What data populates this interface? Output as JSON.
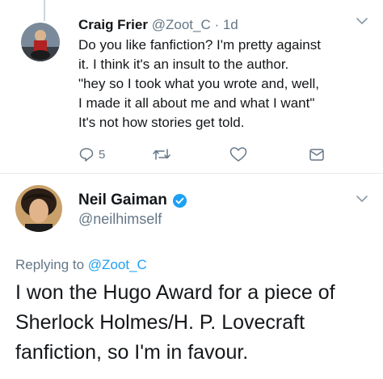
{
  "tweet1": {
    "name": "Craig Frier",
    "handle": "@Zoot_C",
    "time": "· 1d",
    "lines": [
      "Do you like fanfiction? I'm pretty against",
      "it. I think it's an insult to the author.",
      "\"hey so I took what you wrote and, well,",
      "I made it all about me and what I want\"",
      "It's not how stories get told."
    ],
    "reply_count": "5",
    "icons": [
      "reply-icon",
      "retweet-icon",
      "like-icon",
      "message-icon",
      "chevron-down-icon"
    ]
  },
  "tweet2": {
    "name": "Neil Gaiman",
    "handle": "@neilhimself",
    "verified": true,
    "replying_prefix": "Replying to",
    "replying_handle": "@Zoot_C",
    "lines": [
      "I won the Hugo Award for a piece of",
      "Sherlock Holmes/H. P. Lovecraft",
      "fanfiction, so I'm in favour."
    ]
  },
  "colors": {
    "text": "#14171a",
    "muted": "#657786",
    "link": "#1da1f2",
    "divider": "#e6ecf0"
  }
}
